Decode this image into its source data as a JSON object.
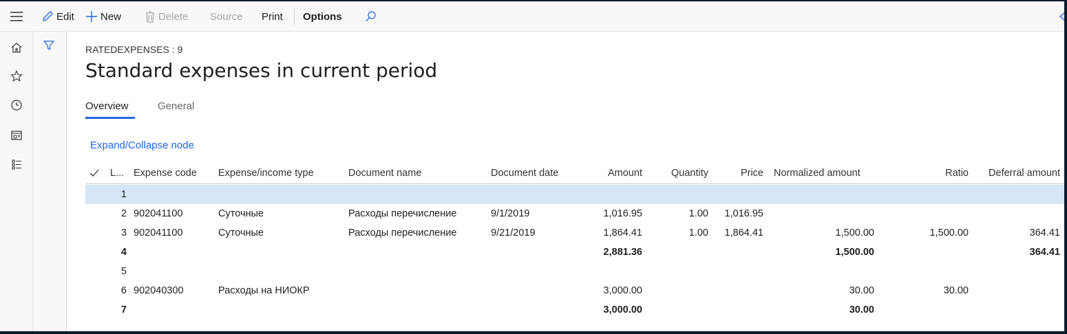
{
  "toolbar": {
    "edit": "Edit",
    "new": "New",
    "delete": "Delete",
    "source": "Source",
    "print": "Print",
    "options": "Options"
  },
  "page": {
    "caption": "RATEDEXPENSES : 9",
    "title": "Standard expenses in current period"
  },
  "tabs": [
    {
      "label": "Overview"
    },
    {
      "label": "General"
    }
  ],
  "expand_link": "Expand/Collapse node",
  "grid": {
    "columns": [
      "L...",
      "Expense code",
      "Expense/income type",
      "Document name",
      "Document date",
      "Amount",
      "Quantity",
      "Price",
      "Normalized amount",
      "Ratio",
      "Deferral amount"
    ],
    "rows": [
      {
        "line": "1",
        "code": "",
        "type": "",
        "doc": "",
        "date": "",
        "amount": "",
        "qty": "",
        "price": "",
        "norm": "",
        "ratio": "",
        "deferral": "",
        "bold": false,
        "selected": true
      },
      {
        "line": "2",
        "code": "902041100",
        "type": "Суточные",
        "doc": "Расходы перечисление",
        "date": "9/1/2019",
        "amount": "1,016.95",
        "qty": "1.00",
        "price": "1,016.95",
        "norm": "",
        "ratio": "",
        "deferral": "",
        "bold": false,
        "selected": false
      },
      {
        "line": "3",
        "code": "902041100",
        "type": "Суточные",
        "doc": "Расходы перечисление",
        "date": "9/21/2019",
        "amount": "1,864.41",
        "qty": "1.00",
        "price": "1,864.41",
        "norm": "1,500.00",
        "ratio": "1,500.00",
        "deferral": "364.41",
        "bold": false,
        "selected": false
      },
      {
        "line": "4",
        "code": "",
        "type": "",
        "doc": "",
        "date": "",
        "amount": "2,881.36",
        "qty": "",
        "price": "",
        "norm": "1,500.00",
        "ratio": "",
        "deferral": "364.41",
        "bold": true,
        "selected": false
      },
      {
        "line": "5",
        "code": "",
        "type": "",
        "doc": "",
        "date": "",
        "amount": "",
        "qty": "",
        "price": "",
        "norm": "",
        "ratio": "",
        "deferral": "",
        "bold": false,
        "selected": false
      },
      {
        "line": "6",
        "code": "902040300",
        "type": "Расходы на НИОКР",
        "doc": "",
        "date": "",
        "amount": "3,000.00",
        "qty": "",
        "price": "",
        "norm": "30.00",
        "ratio": "30.00",
        "deferral": "",
        "bold": false,
        "selected": false
      },
      {
        "line": "7",
        "code": "",
        "type": "",
        "doc": "",
        "date": "",
        "amount": "3,000.00",
        "qty": "",
        "price": "",
        "norm": "30.00",
        "ratio": "",
        "deferral": "",
        "bold": true,
        "selected": false
      }
    ]
  },
  "colors": {
    "accent": "#2266e3",
    "selected_row": "#d6e5f7"
  }
}
